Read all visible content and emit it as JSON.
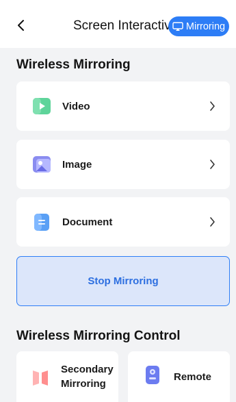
{
  "header": {
    "title": "Screen Interactive",
    "mirroring_button": "Mirroring"
  },
  "sections": {
    "wireless_mirroring": "Wireless Mirroring",
    "wireless_mirroring_control": "Wireless Mirroring Control"
  },
  "mirroring_items": [
    {
      "label": "Video",
      "icon": "video-icon"
    },
    {
      "label": "Image",
      "icon": "image-icon"
    },
    {
      "label": "Document",
      "icon": "document-icon"
    }
  ],
  "stop_button": "Stop Mirroring",
  "control_items": [
    {
      "label": "Secondary\nMirroring",
      "icon": "secondary-mirroring-icon"
    },
    {
      "label": "Remote",
      "icon": "remote-icon"
    }
  ],
  "colors": {
    "accent": "#2d7df6",
    "background": "#f2f3f5",
    "stop_bg": "#dce6fa"
  }
}
